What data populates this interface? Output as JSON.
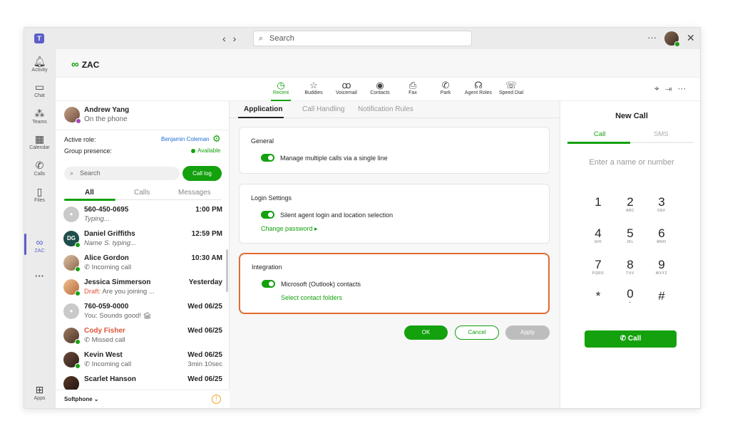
{
  "titlebar": {
    "search_placeholder": "Search",
    "more": "···",
    "close": "✕"
  },
  "rail": [
    {
      "label": "Activity",
      "icon": "bell-icon"
    },
    {
      "label": "Chat",
      "icon": "chat-icon"
    },
    {
      "label": "Teams",
      "icon": "teams-icon"
    },
    {
      "label": "Calendar",
      "icon": "calendar-icon"
    },
    {
      "label": "Calls",
      "icon": "phone-icon"
    },
    {
      "label": "Files",
      "icon": "file-icon"
    },
    {
      "label": "ZAC",
      "icon": "zac-icon"
    },
    {
      "label": "···",
      "icon": "more-icon"
    },
    {
      "label": "Apps",
      "icon": "apps-icon"
    }
  ],
  "app": {
    "name": "ZAC"
  },
  "toolbar": [
    {
      "label": "Recent",
      "icon": "clock-icon"
    },
    {
      "label": "Buddies",
      "icon": "star-icon"
    },
    {
      "label": "Voicemail",
      "icon": "voicemail-icon"
    },
    {
      "label": "Contacts",
      "icon": "contact-icon"
    },
    {
      "label": "Fax",
      "icon": "fax-icon"
    },
    {
      "label": "Park",
      "icon": "park-icon"
    },
    {
      "label": "Agent Roles",
      "icon": "headset-icon"
    },
    {
      "label": "Speed Dial",
      "icon": "speed-dial-icon"
    }
  ],
  "me": {
    "name": "Andrew Yang",
    "status": "On the phone",
    "active_role_label": "Active role:",
    "active_role": "Benjamin Coleman",
    "presence_label": "Group presence:",
    "presence": "Available"
  },
  "left": {
    "search_placeholder": "Search",
    "call_log": "Call log",
    "tabs": [
      "All",
      "Calls",
      "Messages"
    ],
    "conversations": [
      {
        "name": "560-450-0695",
        "sub": "Typing...",
        "time": "1:00 PM",
        "time2": ""
      },
      {
        "name": "Daniel Griffiths",
        "sub": "Name S. typing...",
        "time": "12:59 PM",
        "time2": "",
        "initials": "DG"
      },
      {
        "name": "Alice Gordon",
        "sub": "Incoming call",
        "time": "10:30 AM",
        "time2": ""
      },
      {
        "name": "Jessica Simmerson",
        "draft": "Draft:",
        "sub": " Are you joining  ...",
        "time": "Yesterday",
        "time2": ""
      },
      {
        "name": "760-059-0000",
        "sub": "You: Sounds good! 🏚",
        "time": "Wed 06/25",
        "time2": ""
      },
      {
        "name": "Cody Fisher",
        "sub": "Missed call",
        "time": "Wed 06/25",
        "time2": ""
      },
      {
        "name": "Kevin West",
        "sub": "Incoming call",
        "time": "Wed 06/25",
        "time2": "3min 10sec"
      },
      {
        "name": "Scarlet Hanson",
        "sub": "",
        "time": "Wed 06/25",
        "time2": ""
      }
    ],
    "softphone": "Softphone ⌄",
    "warn": "!"
  },
  "center": {
    "tabs": [
      "Application",
      "Call Handling",
      "Notification Rules"
    ],
    "general": {
      "title": "General",
      "toggle_label": "Manage multiple calls via a single line",
      "toggle_on": true
    },
    "login": {
      "title": "Login Settings",
      "toggle_label": "Silent agent login and location selection",
      "toggle_on": true,
      "link": "Change password  ▸"
    },
    "integration": {
      "title": "Integration",
      "toggle_label": "Microsoft (Outlook) contacts",
      "toggle_on": true,
      "link": "Select contact folders"
    },
    "buttons": {
      "ok": "OK",
      "cancel": "Cancel",
      "apply": "Apply"
    }
  },
  "right": {
    "title": "New Call",
    "tabs": [
      "Call",
      "SMS"
    ],
    "placeholder": "Enter a name or number",
    "keypad": [
      {
        "d": "1",
        "l": ""
      },
      {
        "d": "2",
        "l": "ABC"
      },
      {
        "d": "3",
        "l": "DEF"
      },
      {
        "d": "4",
        "l": "GHI"
      },
      {
        "d": "5",
        "l": "JKL"
      },
      {
        "d": "6",
        "l": "MNO"
      },
      {
        "d": "7",
        "l": "PQRS"
      },
      {
        "d": "8",
        "l": "TUV"
      },
      {
        "d": "9",
        "l": "WXYZ"
      },
      {
        "d": "*",
        "l": ""
      },
      {
        "d": "0",
        "l": "+"
      },
      {
        "d": "#",
        "l": ""
      }
    ],
    "call_button": "Call"
  },
  "colors": {
    "accent": "#13a10e",
    "teams_purple": "#5b5fc7",
    "highlight_border": "#e26b2f",
    "link_blue": "#1f6fd6"
  }
}
